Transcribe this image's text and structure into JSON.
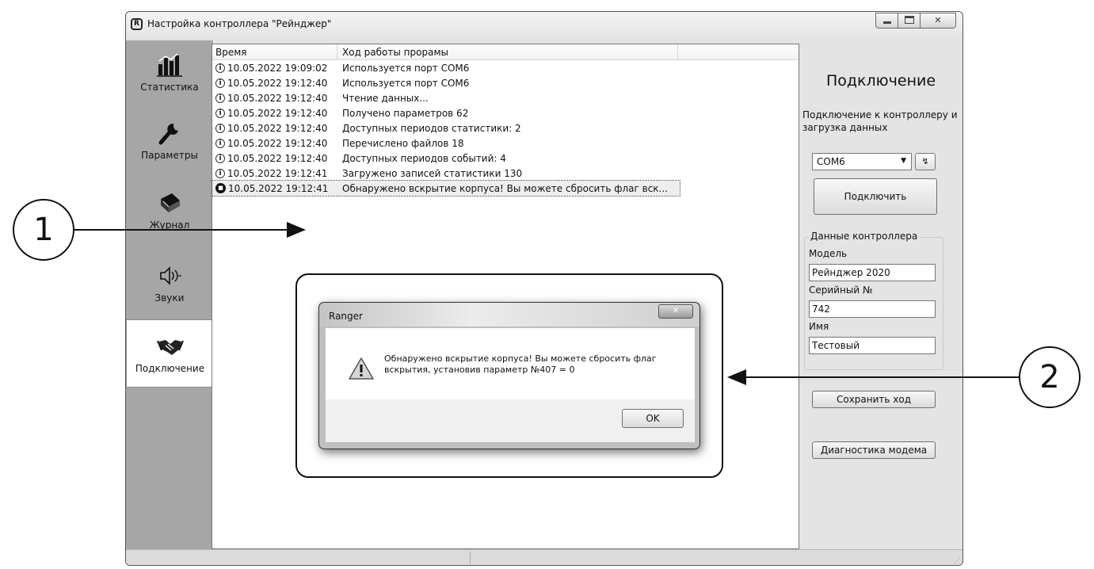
{
  "window": {
    "title": "Настройка контроллера \"Рейнджер\"",
    "icon": "app-logo-icon",
    "controls": [
      "minimize",
      "maximize",
      "close"
    ]
  },
  "nav": {
    "items": [
      {
        "label": "Статистика",
        "icon": "statistics-chart-icon"
      },
      {
        "label": "Параметры",
        "icon": "wrench-icon"
      },
      {
        "label": "Журнал",
        "icon": "journal-book-icon"
      },
      {
        "label": "Звуки",
        "icon": "speaker-icon"
      },
      {
        "label": "Подключение",
        "icon": "handshake-icon",
        "active": true
      }
    ]
  },
  "log": {
    "columns": [
      "Время",
      "Ход работы прорамы"
    ],
    "rows": [
      {
        "time": "10.05.2022 19:09:02",
        "message": "Используется порт COM6",
        "type": "info"
      },
      {
        "time": "10.05.2022 19:12:40",
        "message": "Используется порт COM6",
        "type": "info"
      },
      {
        "time": "10.05.2022 19:12:40",
        "message": "Чтение данных...",
        "type": "info"
      },
      {
        "time": "10.05.2022 19:12:40",
        "message": "Получено параметров 62",
        "type": "info"
      },
      {
        "time": "10.05.2022 19:12:40",
        "message": "Доступных периодов статистики: 2",
        "type": "info"
      },
      {
        "time": "10.05.2022 19:12:40",
        "message": "Перечислено файлов 18",
        "type": "info"
      },
      {
        "time": "10.05.2022 19:12:40",
        "message": "Доступных периодов событий: 4",
        "type": "info"
      },
      {
        "time": "10.05.2022 19:12:41",
        "message": "Загружено записей статистики 130",
        "type": "info"
      },
      {
        "time": "10.05.2022 19:12:41",
        "message": "Обнаружено вскрытие корпуса! Вы можете сбросить флаг вск...",
        "type": "alert",
        "selected": true
      }
    ]
  },
  "panel": {
    "title": "Подключение",
    "description": "Подключение к контроллеру и загрузка данных",
    "port": "COM6",
    "refresh_glyph": "↯",
    "connect_label": "Подключить",
    "group_title": "Данные контроллера",
    "model_label": "Модель",
    "model_value": "Рейнджер 2020",
    "serial_label": "Серийный №",
    "serial_value": "742",
    "name_label": "Имя",
    "name_value": "Тестовый",
    "save_label": "Сохранить ход",
    "diag_label": "Диагностика модема"
  },
  "dialog": {
    "title": "Ranger",
    "message": "Обнаружено вскрытие корпуса! Вы можете сбросить флаг вскрытия, установив параметр №407 = 0",
    "ok_label": "OK",
    "icon": "warning-icon"
  },
  "callouts": [
    "1",
    "2"
  ]
}
